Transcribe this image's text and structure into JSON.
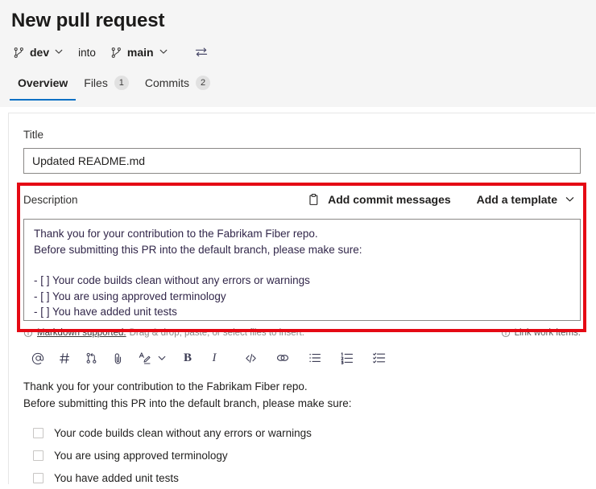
{
  "header": {
    "title": "New pull request",
    "source_branch": "dev",
    "into_label": "into",
    "target_branch": "main",
    "branch_icon": "branch-icon",
    "chevron_icon": "chevron-down-icon",
    "swap_icon": "swap-branches-icon"
  },
  "tabs": [
    {
      "label": "Overview",
      "count": "",
      "active": true
    },
    {
      "label": "Files",
      "count": "1",
      "active": false
    },
    {
      "label": "Commits",
      "count": "2",
      "active": false
    }
  ],
  "title_field": {
    "label": "Title",
    "value": "Updated README.md",
    "placeholder": "Title"
  },
  "description": {
    "label": "Description",
    "add_commit_messages": "Add commit messages",
    "add_template": "Add a template",
    "clipboard_icon": "clipboard-icon",
    "chevron_icon": "chevron-down-icon",
    "lines": [
      "Thank you for your contribution to the Fabrikam Fiber repo.",
      "Before submitting this PR into the default branch, please make sure:",
      "",
      "- [ ] Your code builds clean without any errors or warnings",
      "- [ ] You are using approved terminology",
      "- [ ] You have added unit tests"
    ]
  },
  "hints": {
    "info_icon": "info-icon",
    "markdown_link": "Markdown supported.",
    "drag_drop_text": "Drag & drop, paste, or select files to insert.",
    "link_work_items": "Link work items."
  },
  "toolbar": [
    {
      "name": "mention-icon",
      "glyph": "@"
    },
    {
      "name": "work-item-hash-icon",
      "glyph": "#"
    },
    {
      "name": "pull-request-icon",
      "glyph": ""
    },
    {
      "name": "attachment-paperclip-icon",
      "glyph": ""
    },
    {
      "name": "highlight-pen-icon",
      "glyph": ""
    },
    {
      "name": "chevron-down-icon",
      "glyph": ""
    },
    {
      "name": "bold-icon",
      "glyph": "B"
    },
    {
      "name": "italic-icon",
      "glyph": "I"
    },
    {
      "name": "code-icon",
      "glyph": ""
    },
    {
      "name": "link-icon",
      "glyph": ""
    },
    {
      "name": "bulleted-list-icon",
      "glyph": ""
    },
    {
      "name": "numbered-list-icon",
      "glyph": ""
    },
    {
      "name": "checklist-icon",
      "glyph": ""
    }
  ],
  "preview": {
    "paragraph_lines": [
      "Thank you for your contribution to the Fabrikam Fiber repo.",
      "Before submitting this PR into the default branch, please make sure:"
    ],
    "checklist": [
      {
        "label": "Your code builds clean without any errors or warnings",
        "checked": false
      },
      {
        "label": "You are using approved terminology",
        "checked": false
      },
      {
        "label": "You have added unit tests",
        "checked": false
      }
    ]
  },
  "colors": {
    "accent": "#0a70c4",
    "highlight": "#e50914",
    "header_bg": "#f5f5f5",
    "border": "#8a8886"
  }
}
